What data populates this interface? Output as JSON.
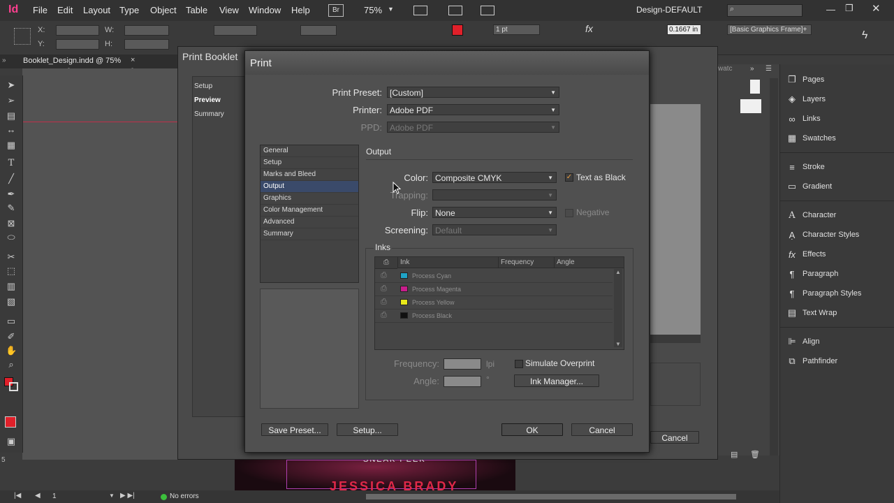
{
  "app": {
    "logo": "Id",
    "menus": [
      "File",
      "Edit",
      "Layout",
      "Type",
      "Object",
      "Table",
      "View",
      "Window",
      "Help"
    ],
    "bridge": "Br",
    "zoom": "75%",
    "workspace": "Design-DEFAULT",
    "search_placeholder": ""
  },
  "control_bar": {
    "x_label": "X:",
    "y_label": "Y:",
    "w_label": "W:",
    "h_label": "H:",
    "stroke_weight": "1 pt",
    "measure": "0.1667 in",
    "object_style": "[Basic Graphics Frame]+"
  },
  "document": {
    "tab_title": "Booklet_Design.indd @ 75%",
    "ruler_marks": [
      "3",
      "2"
    ],
    "vertical_mark": "5",
    "page_number": "1",
    "status": "No errors",
    "poster_line1": "SNEAK PEEK",
    "poster_line2": "JESSICA BRADY"
  },
  "booklet_dialog": {
    "title": "Print Booklet",
    "categories": [
      "Setup",
      "Preview",
      "Summary"
    ],
    "selected": "Preview",
    "cancel_label": "Cancel"
  },
  "panels": {
    "pages_panel_label": "watc",
    "items": [
      "Pages",
      "Layers",
      "Links",
      "Swatches",
      "Stroke",
      "Gradient",
      "Character",
      "Character Styles",
      "Effects",
      "Paragraph",
      "Paragraph Styles",
      "Text Wrap",
      "Align",
      "Pathfinder"
    ],
    "icons": [
      "pages-icon",
      "layers-icon",
      "links-icon",
      "swatches-icon",
      "stroke-icon",
      "gradient-icon",
      "character-icon",
      "character-styles-icon",
      "effects-icon",
      "paragraph-icon",
      "paragraph-styles-icon",
      "text-wrap-icon",
      "align-icon",
      "pathfinder-icon"
    ]
  },
  "print_dialog": {
    "title": "Print",
    "preset_label": "Print Preset:",
    "preset_value": "[Custom]",
    "printer_label": "Printer:",
    "printer_value": "Adobe PDF",
    "ppd_label": "PPD:",
    "ppd_value": "Adobe PDF",
    "categories": [
      "General",
      "Setup",
      "Marks and Bleed",
      "Output",
      "Graphics",
      "Color Management",
      "Advanced",
      "Summary"
    ],
    "selected_category": "Output",
    "section_title": "Output",
    "color_label": "Color:",
    "color_value": "Composite CMYK",
    "text_as_black_label": "Text as Black",
    "text_as_black_checked": true,
    "trapping_label": "Trapping:",
    "trapping_value": "",
    "flip_label": "Flip:",
    "flip_value": "None",
    "negative_label": "Negative",
    "screening_label": "Screening:",
    "screening_value": "Default",
    "inks_title": "Inks",
    "ink_columns": [
      "Ink",
      "Frequency",
      "Angle"
    ],
    "inks": [
      {
        "name": "Process Cyan",
        "color": "#1fa3c6"
      },
      {
        "name": "Process Magenta",
        "color": "#c81e8c"
      },
      {
        "name": "Process Yellow",
        "color": "#e8e81a"
      },
      {
        "name": "Process Black",
        "color": "#101010"
      }
    ],
    "frequency_label": "Frequency:",
    "frequency_unit": "lpi",
    "angle_label": "Angle:",
    "angle_unit": "°",
    "simulate_overprint_label": "Simulate Overprint",
    "ink_manager_label": "Ink Manager...",
    "save_preset_label": "Save Preset...",
    "setup_label": "Setup...",
    "ok_label": "OK",
    "cancel_label": "Cancel"
  }
}
